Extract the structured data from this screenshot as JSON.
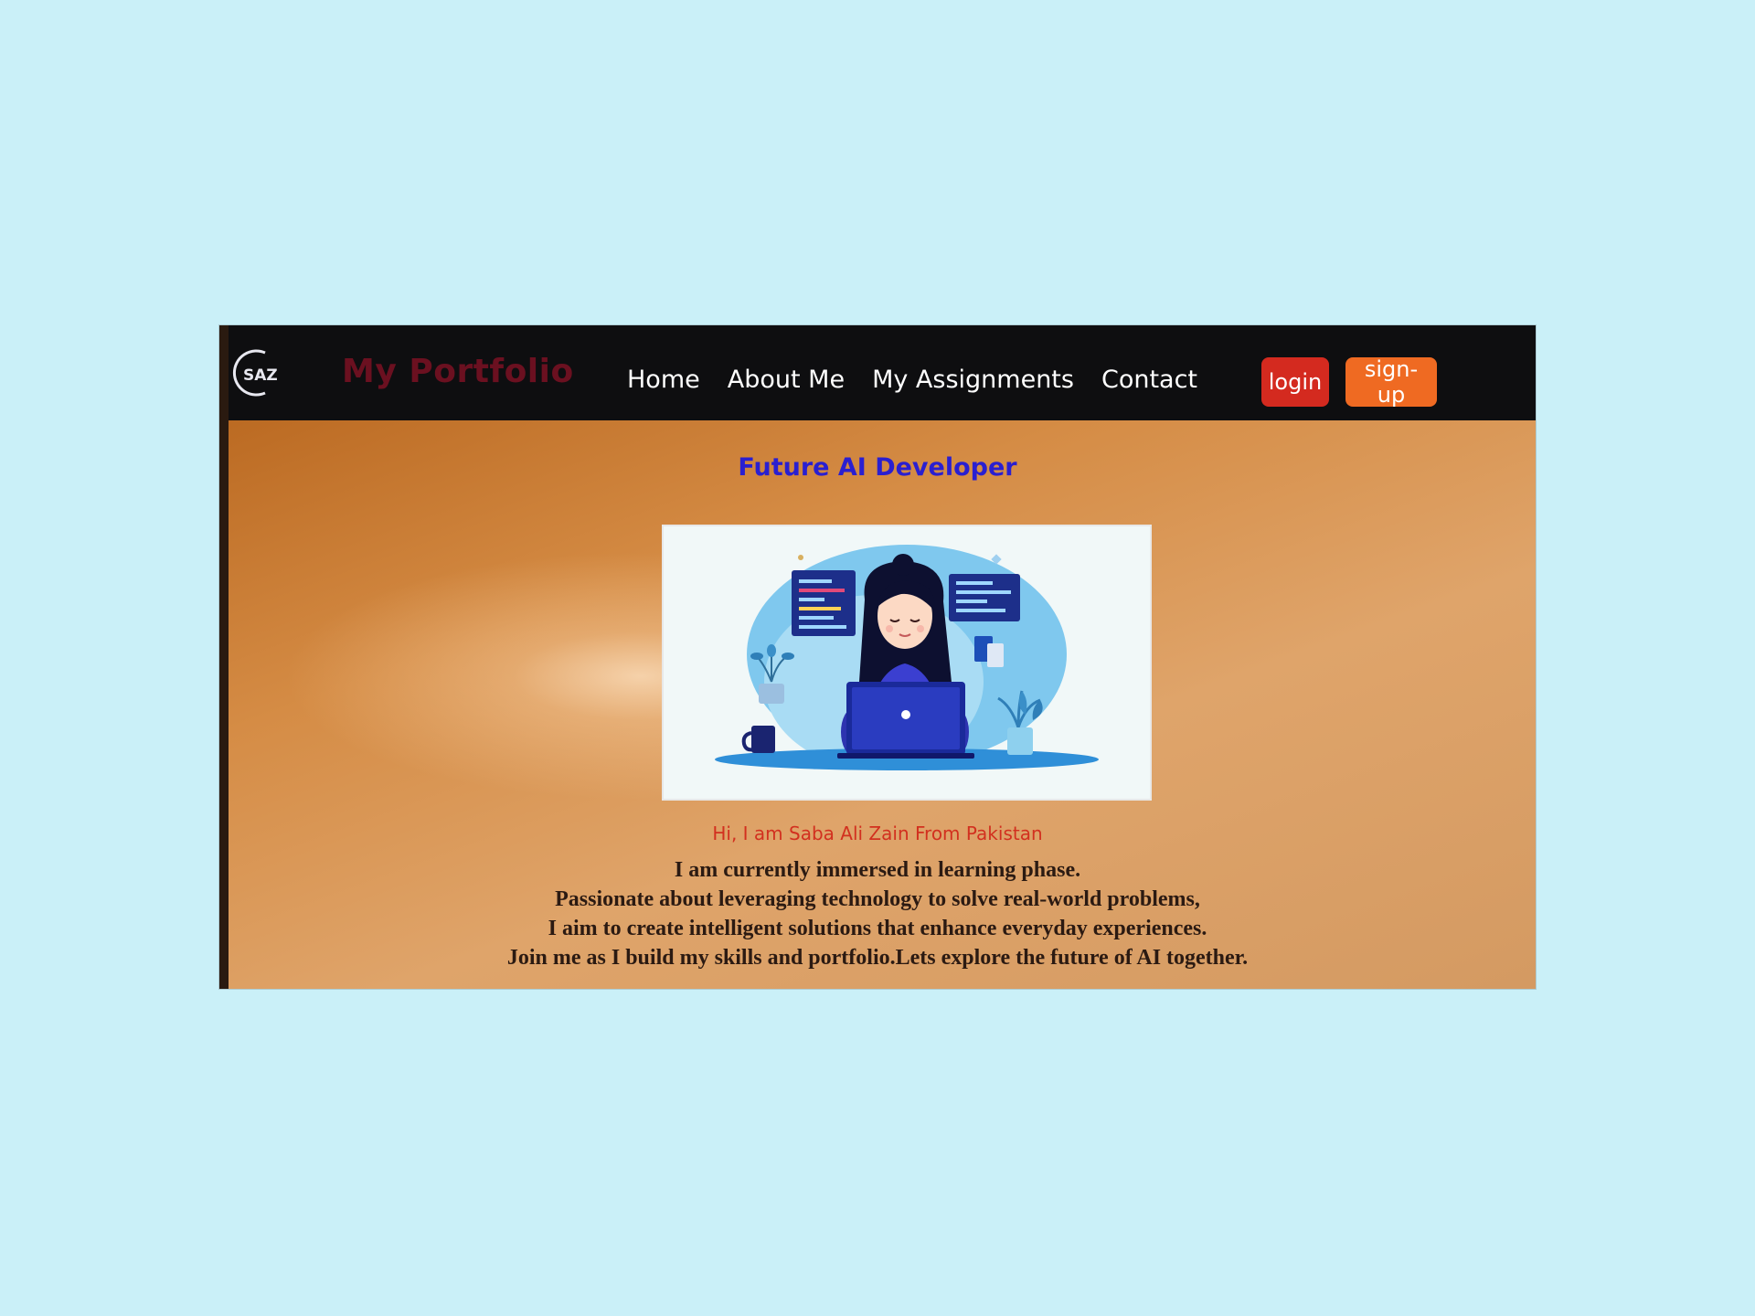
{
  "navbar": {
    "logo_text": "SAZ",
    "brand": "My Portfolio",
    "links": [
      "Home",
      "About Me",
      "My Assignments",
      "Contact"
    ],
    "login_label": "login",
    "signup_label": "sign-up"
  },
  "hero": {
    "headline": "Future AI Developer",
    "image_icon": "developer-illustration-icon",
    "intro": "Hi, I am Saba Ali Zain From Pakistan",
    "bio_lines": [
      "I am currently immersed in learning phase.",
      "Passionate about leveraging technology to solve real-world problems,",
      "I aim to create intelligent solutions that enhance everyday experiences.",
      "Join me as I build my skills and portfolio.Lets explore the future of AI together."
    ]
  },
  "colors": {
    "background": "#caf0f8",
    "navbar": "#0e0e10",
    "brand": "#6b1020",
    "headline": "#2a1fd0",
    "intro": "#d2301f",
    "login": "#d42a1f",
    "signup": "#ef6a22"
  }
}
